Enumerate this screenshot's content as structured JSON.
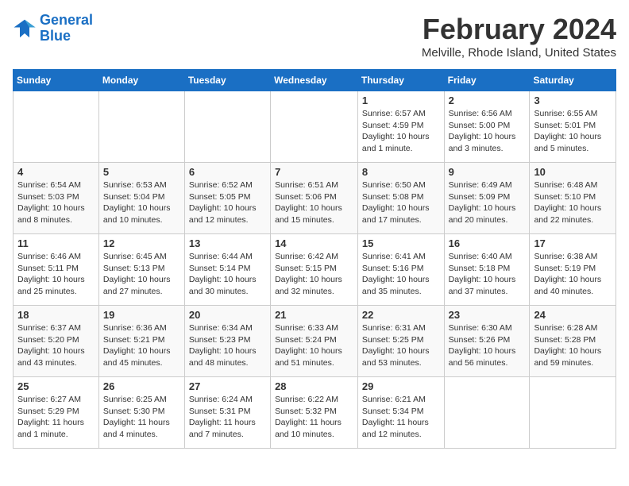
{
  "header": {
    "logo_line1": "General",
    "logo_line2": "Blue",
    "month": "February 2024",
    "location": "Melville, Rhode Island, United States"
  },
  "days_of_week": [
    "Sunday",
    "Monday",
    "Tuesday",
    "Wednesday",
    "Thursday",
    "Friday",
    "Saturday"
  ],
  "weeks": [
    [
      {
        "day": "",
        "info": ""
      },
      {
        "day": "",
        "info": ""
      },
      {
        "day": "",
        "info": ""
      },
      {
        "day": "",
        "info": ""
      },
      {
        "day": "1",
        "info": "Sunrise: 6:57 AM\nSunset: 4:59 PM\nDaylight: 10 hours and 1 minute."
      },
      {
        "day": "2",
        "info": "Sunrise: 6:56 AM\nSunset: 5:00 PM\nDaylight: 10 hours and 3 minutes."
      },
      {
        "day": "3",
        "info": "Sunrise: 6:55 AM\nSunset: 5:01 PM\nDaylight: 10 hours and 5 minutes."
      }
    ],
    [
      {
        "day": "4",
        "info": "Sunrise: 6:54 AM\nSunset: 5:03 PM\nDaylight: 10 hours and 8 minutes."
      },
      {
        "day": "5",
        "info": "Sunrise: 6:53 AM\nSunset: 5:04 PM\nDaylight: 10 hours and 10 minutes."
      },
      {
        "day": "6",
        "info": "Sunrise: 6:52 AM\nSunset: 5:05 PM\nDaylight: 10 hours and 12 minutes."
      },
      {
        "day": "7",
        "info": "Sunrise: 6:51 AM\nSunset: 5:06 PM\nDaylight: 10 hours and 15 minutes."
      },
      {
        "day": "8",
        "info": "Sunrise: 6:50 AM\nSunset: 5:08 PM\nDaylight: 10 hours and 17 minutes."
      },
      {
        "day": "9",
        "info": "Sunrise: 6:49 AM\nSunset: 5:09 PM\nDaylight: 10 hours and 20 minutes."
      },
      {
        "day": "10",
        "info": "Sunrise: 6:48 AM\nSunset: 5:10 PM\nDaylight: 10 hours and 22 minutes."
      }
    ],
    [
      {
        "day": "11",
        "info": "Sunrise: 6:46 AM\nSunset: 5:11 PM\nDaylight: 10 hours and 25 minutes."
      },
      {
        "day": "12",
        "info": "Sunrise: 6:45 AM\nSunset: 5:13 PM\nDaylight: 10 hours and 27 minutes."
      },
      {
        "day": "13",
        "info": "Sunrise: 6:44 AM\nSunset: 5:14 PM\nDaylight: 10 hours and 30 minutes."
      },
      {
        "day": "14",
        "info": "Sunrise: 6:42 AM\nSunset: 5:15 PM\nDaylight: 10 hours and 32 minutes."
      },
      {
        "day": "15",
        "info": "Sunrise: 6:41 AM\nSunset: 5:16 PM\nDaylight: 10 hours and 35 minutes."
      },
      {
        "day": "16",
        "info": "Sunrise: 6:40 AM\nSunset: 5:18 PM\nDaylight: 10 hours and 37 minutes."
      },
      {
        "day": "17",
        "info": "Sunrise: 6:38 AM\nSunset: 5:19 PM\nDaylight: 10 hours and 40 minutes."
      }
    ],
    [
      {
        "day": "18",
        "info": "Sunrise: 6:37 AM\nSunset: 5:20 PM\nDaylight: 10 hours and 43 minutes."
      },
      {
        "day": "19",
        "info": "Sunrise: 6:36 AM\nSunset: 5:21 PM\nDaylight: 10 hours and 45 minutes."
      },
      {
        "day": "20",
        "info": "Sunrise: 6:34 AM\nSunset: 5:23 PM\nDaylight: 10 hours and 48 minutes."
      },
      {
        "day": "21",
        "info": "Sunrise: 6:33 AM\nSunset: 5:24 PM\nDaylight: 10 hours and 51 minutes."
      },
      {
        "day": "22",
        "info": "Sunrise: 6:31 AM\nSunset: 5:25 PM\nDaylight: 10 hours and 53 minutes."
      },
      {
        "day": "23",
        "info": "Sunrise: 6:30 AM\nSunset: 5:26 PM\nDaylight: 10 hours and 56 minutes."
      },
      {
        "day": "24",
        "info": "Sunrise: 6:28 AM\nSunset: 5:28 PM\nDaylight: 10 hours and 59 minutes."
      }
    ],
    [
      {
        "day": "25",
        "info": "Sunrise: 6:27 AM\nSunset: 5:29 PM\nDaylight: 11 hours and 1 minute."
      },
      {
        "day": "26",
        "info": "Sunrise: 6:25 AM\nSunset: 5:30 PM\nDaylight: 11 hours and 4 minutes."
      },
      {
        "day": "27",
        "info": "Sunrise: 6:24 AM\nSunset: 5:31 PM\nDaylight: 11 hours and 7 minutes."
      },
      {
        "day": "28",
        "info": "Sunrise: 6:22 AM\nSunset: 5:32 PM\nDaylight: 11 hours and 10 minutes."
      },
      {
        "day": "29",
        "info": "Sunrise: 6:21 AM\nSunset: 5:34 PM\nDaylight: 11 hours and 12 minutes."
      },
      {
        "day": "",
        "info": ""
      },
      {
        "day": "",
        "info": ""
      }
    ]
  ]
}
